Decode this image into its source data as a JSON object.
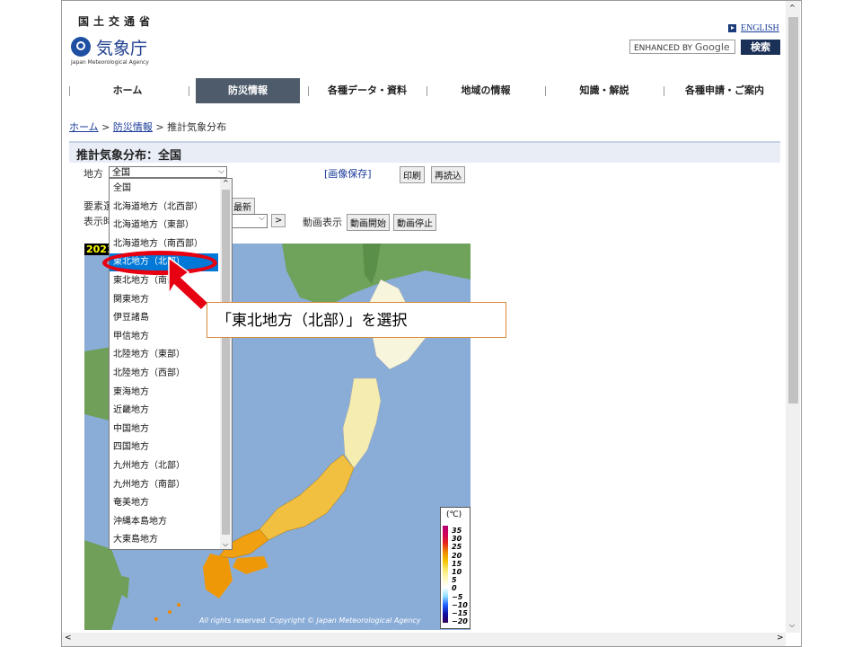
{
  "header": {
    "org_top": "国土交通省",
    "org_name": "気象庁",
    "org_sub": "Japan Meteorological Agency",
    "english_link": "ENGLISH",
    "search_placeholder_brand": "ENHANCED BY",
    "search_placeholder_google": "Google",
    "search_button": "検索"
  },
  "nav": [
    "ホーム",
    "防災情報",
    "各種データ・資料",
    "地域の情報",
    "知識・解説",
    "各種申請・ご案内"
  ],
  "breadcrumb": {
    "home": "ホーム",
    "sep1": ">",
    "disaster": "防災情報",
    "sep2": ">",
    "current": "推計気象分布"
  },
  "page_title": "推計気象分布：全国",
  "controls": {
    "region_label": "地方",
    "region_value": "全国",
    "save_image": "[画像保存]",
    "print": "印刷",
    "reload": "再読込",
    "element_label": "要素選",
    "latest": "最新",
    "display_label": "表示時",
    "next": ">",
    "animation_label": "動画表示",
    "anim_start": "動画開始",
    "anim_stop": "動画停止"
  },
  "dropdown_options": [
    "全国",
    "北海道地方（北西部）",
    "北海道地方（東部）",
    "北海道地方（南西部）",
    "東北地方（北部）",
    "東北地方（南部）",
    "関東地方",
    "伊豆諸島",
    "甲信地方",
    "北陸地方（東部）",
    "北陸地方（西部）",
    "東海地方",
    "近畿地方",
    "中国地方",
    "四国地方",
    "九州地方（北部）",
    "九州地方（南部）",
    "奄美地方",
    "沖縄本島地方",
    "大東島地方"
  ],
  "dropdown_selected_index": 4,
  "map": {
    "year_text": "2021",
    "unit": "(℃)",
    "scale_labels": [
      "35",
      "30",
      "25",
      "20",
      "15",
      "10",
      "5",
      "0",
      "−5",
      "−10",
      "−15",
      "−20"
    ],
    "copyright": "All rights reserved. Copyright © Japan Meteorological Agency"
  },
  "annotation": "「東北地方（北部）」を選択",
  "colors": {
    "nav_active": "#4d5b6b",
    "selection": "#0078d7",
    "ring": "#e60012",
    "sea": "#8aadd8",
    "land": "#f0a010"
  }
}
